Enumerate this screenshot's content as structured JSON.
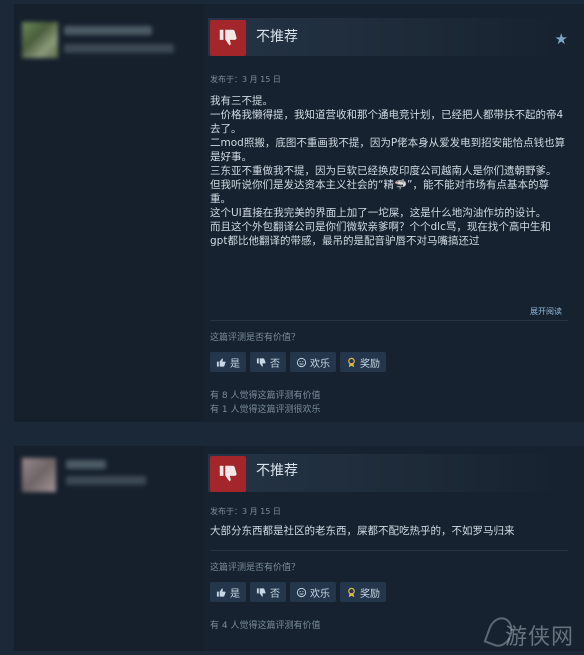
{
  "reviews": [
    {
      "verdict": "不推荐",
      "posted": "发布于：3 月 15 日",
      "paragraphs": [
        "我有三不提。",
        "一价格我懒得提，我知道营收和那个通电竞计划，已经把人都带扶不起的帝4去了。",
        "二mod照搬，底图不重画我不提，因为P佬本身从爱发电到招安能恰点钱也算是好事。",
        "三东亚不重做我不提，因为巨软已经换皮印度公司越南人是你们遗朝野爹。",
        "但我听说你们是发达资本主义社会的“精🦈”，能不能对市场有点基本的尊重。",
        "这个UI直接在我完美的界面上加了一坨屎，这是什么地沟油作坊的设计。",
        "而且这个外包翻译公司是你们微软亲爹啊？个个dlc骂，现在找个高中生和gpt都比他翻译的带感，最吊的是配音驴唇不对马嘴搞还过"
      ],
      "read_more": "展开阅读",
      "helpful_question": "这篇评测是否有价值？",
      "buttons": {
        "yes": "是",
        "no": "否",
        "funny": "欢乐",
        "award": "奖励"
      },
      "stats": [
        "有 8 人觉得这篇评测有价值",
        "有 1 人觉得这篇评测很欢乐"
      ]
    },
    {
      "verdict": "不推荐",
      "posted": "发布于：3 月 15 日",
      "paragraphs": [
        "大部分东西都是社区的老东西，屎都不配吃热乎的，不如罗马归来"
      ],
      "helpful_question": "这篇评测是否有价值？",
      "buttons": {
        "yes": "是",
        "no": "否",
        "funny": "欢乐",
        "award": "奖励"
      },
      "stats": [
        "有 4 人觉得这篇评测有价值"
      ]
    }
  ],
  "watermark": "游侠网",
  "colors": {
    "background": "#1b2838",
    "thumb_down": "#a3262a",
    "button": "#24364b",
    "link": "#8fb9dc"
  },
  "icons": {
    "verdict": "thumbs-down-icon",
    "star": "star-icon",
    "yes": "thumbs-up-icon",
    "no": "thumbs-down-icon",
    "funny": "smile-icon",
    "award": "award-icon"
  }
}
